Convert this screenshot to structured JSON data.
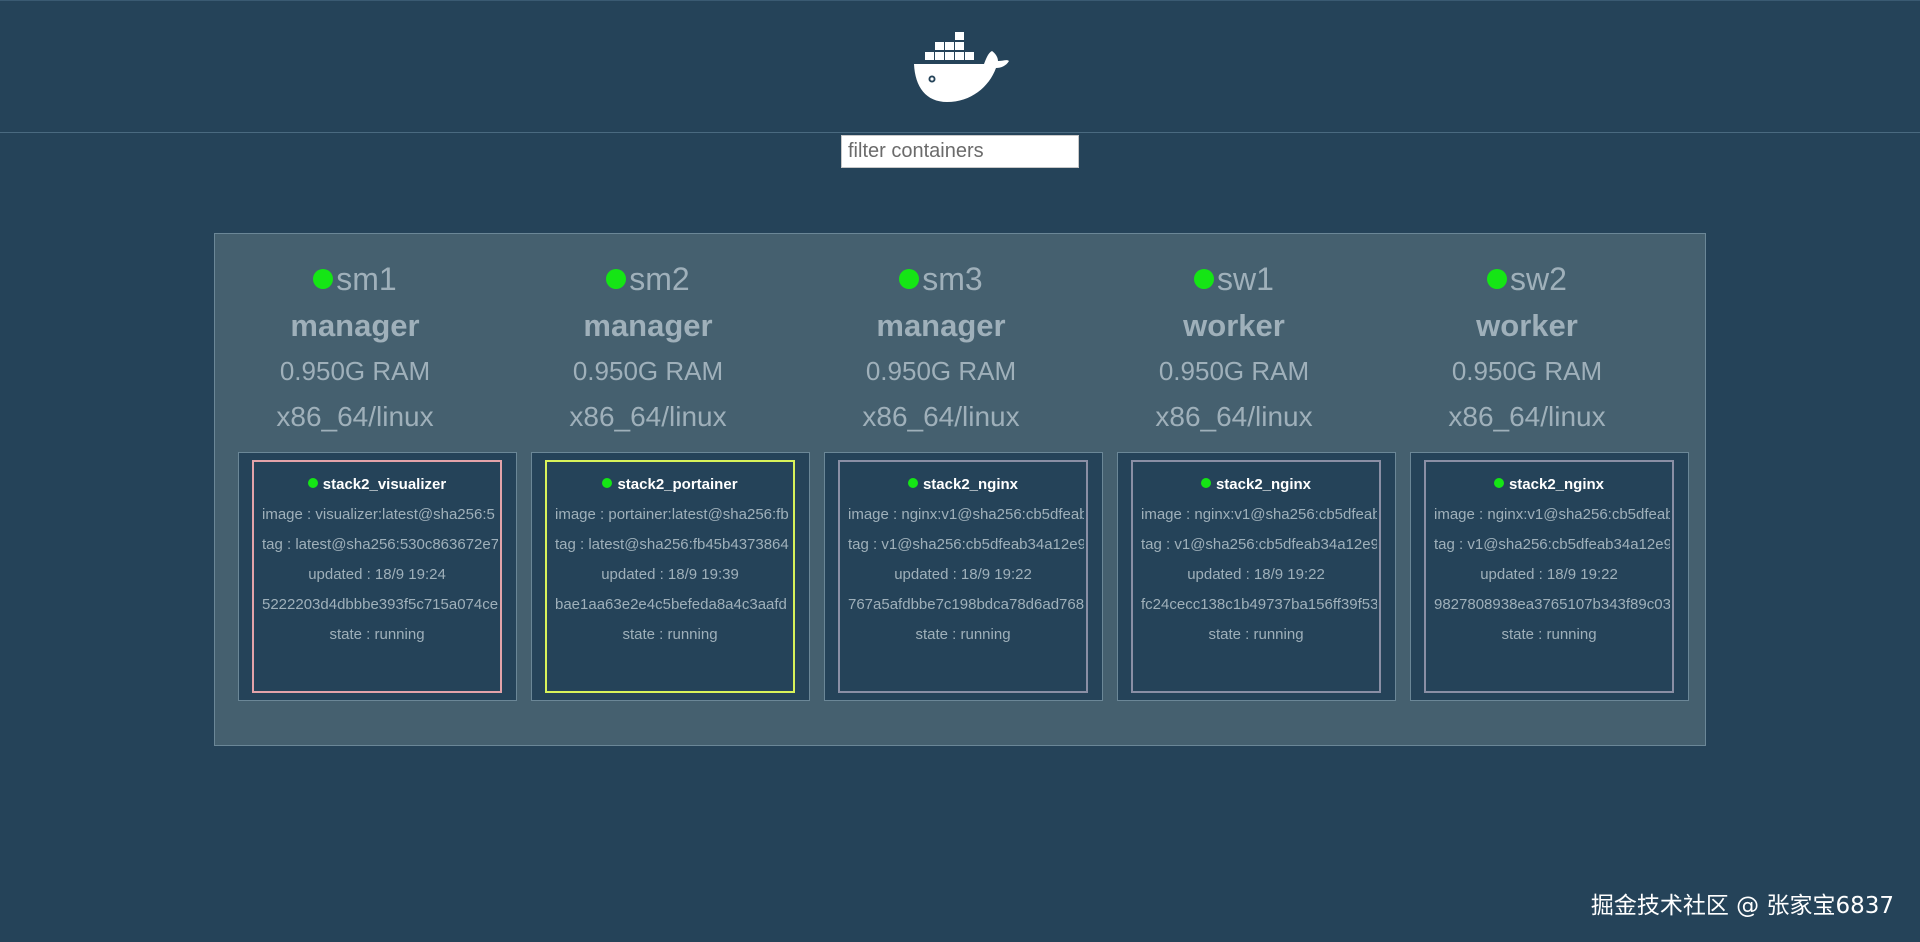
{
  "filter": {
    "placeholder": "filter containers"
  },
  "nodes": [
    {
      "name": "sm1",
      "role": "manager",
      "ram": "0.950G RAM",
      "arch": "x86_64/linux",
      "task": {
        "name": "stack2_visualizer",
        "image": "image : visualizer:latest@sha256:5",
        "tag": "tag : latest@sha256:530c863672e7",
        "updated": "updated : 18/9 19:24",
        "id": "5222203d4dbbbe393f5c715a074ce",
        "state": "state : running",
        "border_color": "#e3a3a9"
      }
    },
    {
      "name": "sm2",
      "role": "manager",
      "ram": "0.950G RAM",
      "arch": "x86_64/linux",
      "task": {
        "name": "stack2_portainer",
        "image": "image : portainer:latest@sha256:fb",
        "tag": "tag : latest@sha256:fb45b4373864",
        "updated": "updated : 18/9 19:39",
        "id": "bae1aa63e2e4c5befeda8a4c3aafd",
        "state": "state : running",
        "border_color": "#d8f25a"
      }
    },
    {
      "name": "sm3",
      "role": "manager",
      "ram": "0.950G RAM",
      "arch": "x86_64/linux",
      "task": {
        "name": "stack2_nginx",
        "image": "image : nginx:v1@sha256:cb5dfeab",
        "tag": "tag : v1@sha256:cb5dfeab34a12e9",
        "updated": "updated : 18/9 19:22",
        "id": "767a5afdbbe7c198bdca78d6ad768",
        "state": "state : running",
        "border_color": "#8a8fa5"
      }
    },
    {
      "name": "sw1",
      "role": "worker",
      "ram": "0.950G RAM",
      "arch": "x86_64/linux",
      "task": {
        "name": "stack2_nginx",
        "image": "image : nginx:v1@sha256:cb5dfeab",
        "tag": "tag : v1@sha256:cb5dfeab34a12e9",
        "updated": "updated : 18/9 19:22",
        "id": "fc24cecc138c1b49737ba156ff39f53",
        "state": "state : running",
        "border_color": "#8a8fa5"
      }
    },
    {
      "name": "sw2",
      "role": "worker",
      "ram": "0.950G RAM",
      "arch": "x86_64/linux",
      "task": {
        "name": "stack2_nginx",
        "image": "image : nginx:v1@sha256:cb5dfeab",
        "tag": "tag : v1@sha256:cb5dfeab34a12e9",
        "updated": "updated : 18/9 19:22",
        "id": "9827808938ea3765107b343f89c03",
        "state": "state : running",
        "border_color": "#8a8fa5"
      }
    }
  ],
  "status_color": "#15e515",
  "watermark": "掘金技术社区 @ 张家宝6837"
}
